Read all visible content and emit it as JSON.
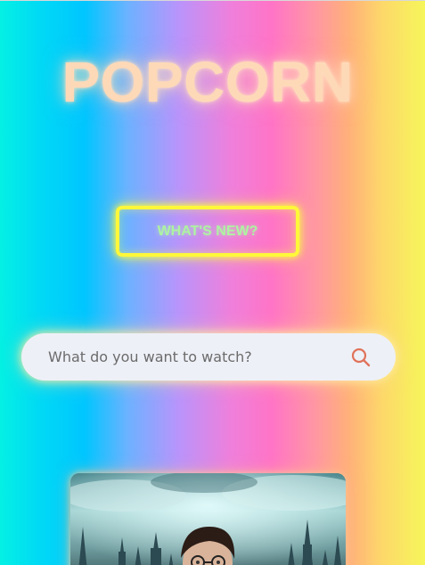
{
  "brand": {
    "title": "POPCORN"
  },
  "whats_new": {
    "label": "WHAT'S NEW?"
  },
  "search": {
    "placeholder": "What do you want to watch?",
    "value": "",
    "icon": "search-icon"
  },
  "colors": {
    "title": "#fed9b8",
    "button_border": "#fff83a",
    "button_text": "#aef2a2",
    "search_bg": "#eef0f7",
    "search_icon": "#e0725a"
  },
  "featured": {
    "poster": "movie-poster-image"
  }
}
